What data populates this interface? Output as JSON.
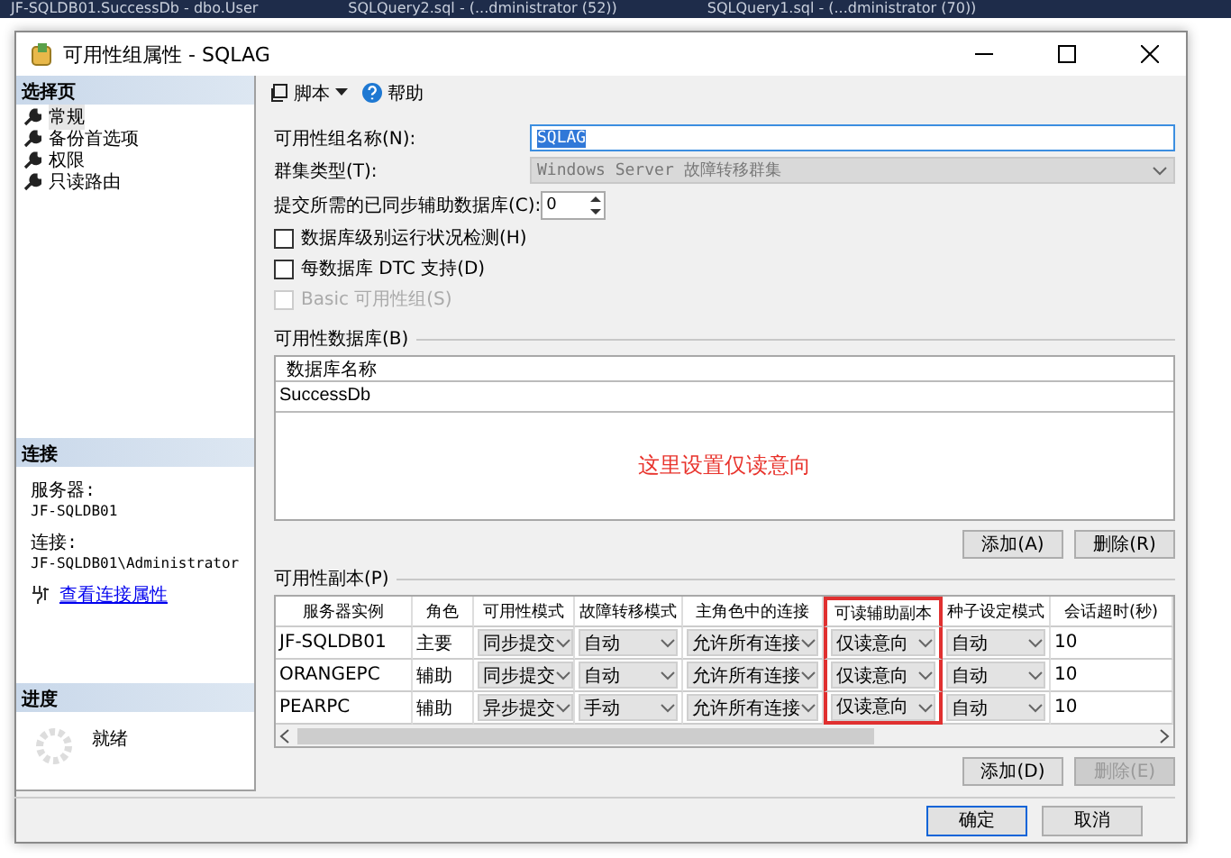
{
  "background_tabs": [
    "JF-SQLDB01.SuccessDb - dbo.User",
    "SQLQuery2.sql - (...dministrator (52))",
    "SQLQuery1.sql - (...dministrator (70))"
  ],
  "window": {
    "title": "可用性组属性 - SQLAG"
  },
  "sidebar": {
    "header": "选择页",
    "items": [
      {
        "label": "常规",
        "selected": true
      },
      {
        "label": "备份首选项",
        "selected": false
      },
      {
        "label": "权限",
        "selected": false
      },
      {
        "label": "只读路由",
        "selected": false
      }
    ],
    "connection": {
      "header": "连接",
      "server_label": "服务器:",
      "server": "JF-SQLDB01",
      "connection_label": "连接:",
      "connection": "JF-SQLDB01\\Administrator",
      "link": "查看连接属性"
    },
    "progress": {
      "header": "进度",
      "status": "就绪"
    }
  },
  "toolbar": {
    "script": "脚本",
    "help": "帮助"
  },
  "form": {
    "name_label": "可用性组名称(N):",
    "name_value": "SQLAG",
    "cluster_label": "群集类型(T):",
    "cluster_value": "Windows Server 故障转移群集",
    "sync_label": "提交所需的已同步辅助数据库(C):",
    "sync_value": "0",
    "checkboxes": [
      {
        "label": "数据库级别运行状况检测(H)",
        "checked": false,
        "disabled": false
      },
      {
        "label": "每数据库 DTC 支持(D)",
        "checked": false,
        "disabled": false
      },
      {
        "label": "Basic 可用性组(S)",
        "checked": false,
        "disabled": true
      }
    ]
  },
  "databases": {
    "title": "可用性数据库(B)",
    "column": "数据库名称",
    "rows": [
      "SuccessDb"
    ],
    "annotation": "这里设置仅读意向",
    "buttons": [
      {
        "label": "添加(A)",
        "disabled": false
      },
      {
        "label": "删除(R)",
        "disabled": false
      }
    ]
  },
  "replicas": {
    "title": "可用性副本(P)",
    "columns": [
      {
        "label": "服务器实例",
        "kind": "text",
        "highlighted": false
      },
      {
        "label": "角色",
        "kind": "text",
        "highlighted": false
      },
      {
        "label": "可用性模式",
        "kind": "dropdown",
        "highlighted": false
      },
      {
        "label": "故障转移模式",
        "kind": "dropdown",
        "highlighted": false
      },
      {
        "label": "主角色中的连接",
        "kind": "dropdown",
        "highlighted": false
      },
      {
        "label": "可读辅助副本",
        "kind": "dropdown",
        "highlighted": true
      },
      {
        "label": "种子设定模式",
        "kind": "dropdown",
        "highlighted": false
      },
      {
        "label": "会话超时(秒)",
        "kind": "text",
        "highlighted": false
      }
    ],
    "rows": [
      [
        "JF-SQLDB01",
        "主要",
        "同步提交",
        "自动",
        "允许所有连接",
        "仅读意向",
        "自动",
        "10"
      ],
      [
        "ORANGEPC",
        "辅助",
        "同步提交",
        "自动",
        "允许所有连接",
        "仅读意向",
        "自动",
        "10"
      ],
      [
        "PEARPC",
        "辅助",
        "异步提交",
        "手动",
        "允许所有连接",
        "仅读意向",
        "自动",
        "10"
      ]
    ],
    "buttons": [
      {
        "label": "添加(D)",
        "disabled": false
      },
      {
        "label": "删除(E)",
        "disabled": true
      }
    ]
  },
  "footer": {
    "buttons": [
      {
        "label": "确定",
        "default": true
      },
      {
        "label": "取消",
        "default": false
      }
    ]
  }
}
